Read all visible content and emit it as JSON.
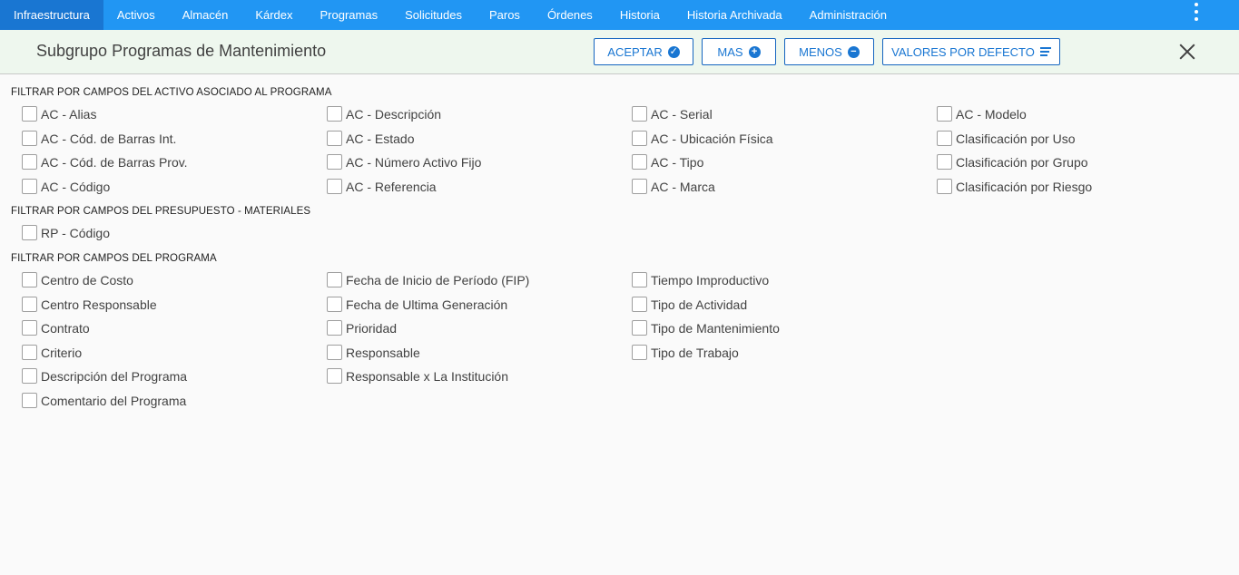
{
  "nav": {
    "items": [
      "Infraestructura",
      "Activos",
      "Almacén",
      "Kárdex",
      "Programas",
      "Solicitudes",
      "Paros",
      "Órdenes",
      "Historia",
      "Historia Archivada",
      "Administración"
    ],
    "active_index": 0
  },
  "header": {
    "title": "Subgrupo Programas de Mantenimiento",
    "buttons": {
      "accept": "ACEPTAR",
      "more": "MAS",
      "less": "MENOS",
      "defaults": "VALORES POR DEFECTO"
    }
  },
  "sections": [
    {
      "title": "FILTRAR POR CAMPOS DEL ACTIVO ASOCIADO AL PROGRAMA",
      "columns": [
        [
          "AC - Alias",
          "AC - Cód. de Barras Int.",
          "AC - Cód. de Barras Prov.",
          "AC - Código"
        ],
        [
          "AC - Descripción",
          "AC - Estado",
          "AC - Número Activo Fijo",
          "AC - Referencia"
        ],
        [
          "AC - Serial",
          "AC - Ubicación Física",
          "AC - Tipo",
          "AC - Marca"
        ],
        [
          "AC - Modelo",
          "Clasificación por Uso",
          "Clasificación por Grupo",
          "Clasificación por Riesgo"
        ]
      ]
    },
    {
      "title": "FILTRAR POR CAMPOS DEL PRESUPUESTO - MATERIALES",
      "columns": [
        [
          "RP - Código"
        ]
      ]
    },
    {
      "title": "FILTRAR POR CAMPOS DEL PROGRAMA",
      "columns": [
        [
          "Centro de Costo",
          "Centro Responsable",
          "Contrato",
          "Criterio",
          "Descripción del Programa",
          "Comentario del Programa"
        ],
        [
          "Fecha de Inicio de Período (FIP)",
          "Fecha de Ultima Generación",
          "Prioridad",
          "Responsable",
          "Responsable x La Institución"
        ],
        [
          "Tiempo Improductivo",
          "Tipo de Actividad",
          "Tipo de Mantenimiento",
          "Tipo de Trabajo"
        ]
      ]
    }
  ],
  "colors": {
    "nav_bg": "#2196f3",
    "nav_active": "#1976d2",
    "header_bg": "#eef7ee",
    "accent": "#1976d2"
  }
}
